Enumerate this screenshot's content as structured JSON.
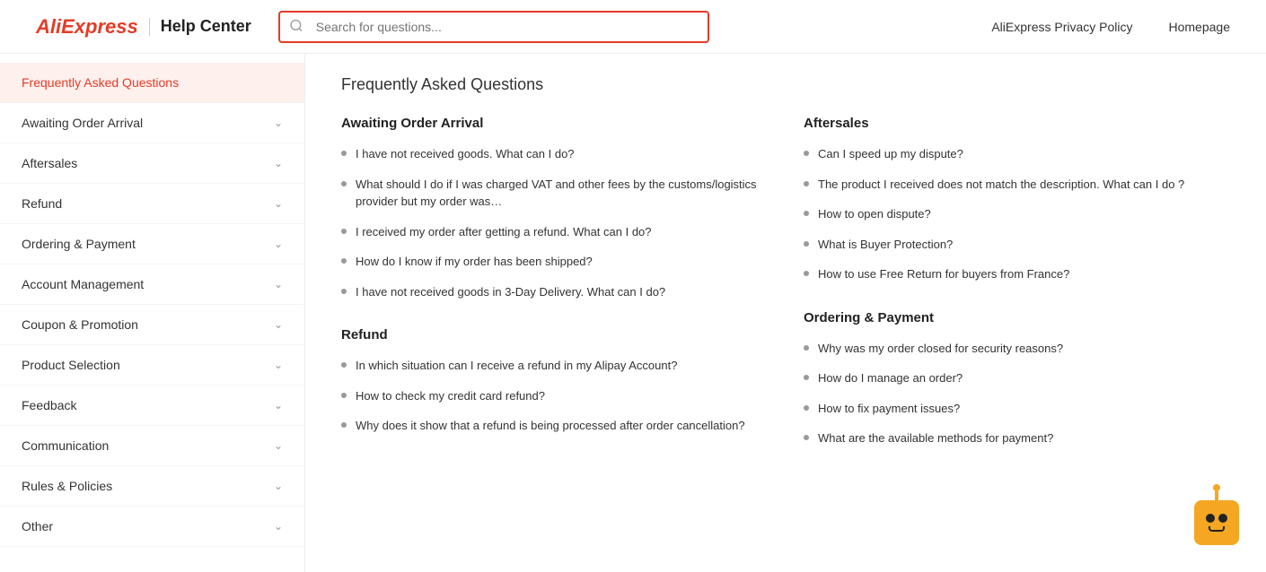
{
  "header": {
    "logo_aliexpress": "AliExpress",
    "logo_divider": "|",
    "logo_helpcenter": "Help Center",
    "search_placeholder": "Search for questions...",
    "nav_links": [
      {
        "label": "AliExpress Privacy Policy"
      },
      {
        "label": "Homepage"
      }
    ]
  },
  "sidebar": {
    "items": [
      {
        "label": "Frequently Asked Questions",
        "active": true
      },
      {
        "label": "Awaiting Order Arrival",
        "active": false
      },
      {
        "label": "Aftersales",
        "active": false
      },
      {
        "label": "Refund",
        "active": false
      },
      {
        "label": "Ordering & Payment",
        "active": false
      },
      {
        "label": "Account Management",
        "active": false
      },
      {
        "label": "Coupon & Promotion",
        "active": false
      },
      {
        "label": "Product Selection",
        "active": false
      },
      {
        "label": "Feedback",
        "active": false
      },
      {
        "label": "Communication",
        "active": false
      },
      {
        "label": "Rules & Policies",
        "active": false
      },
      {
        "label": "Other",
        "active": false
      }
    ]
  },
  "content": {
    "page_title": "Frequently Asked Questions",
    "sections": [
      {
        "title": "Awaiting Order Arrival",
        "items": [
          "I have not received goods. What can I do?",
          "What should I do if I was charged VAT and other fees by the customs/logistics provider but my order was…",
          "I received my order after getting a refund. What can I do?",
          "How do I know if my order has been shipped?",
          "I have not received goods in 3-Day Delivery. What can I do?"
        ]
      },
      {
        "title": "Aftersales",
        "items": [
          "Can I speed up my dispute?",
          "The product I received does not match the description. What can I do ?",
          "How to open dispute?",
          "What is Buyer Protection?",
          "How to use Free Return for buyers from France?"
        ]
      },
      {
        "title": "Refund",
        "items": [
          "In which situation can I receive a refund in my Alipay Account?",
          "How to check my credit card refund?",
          "Why does it show that a refund is being processed after order cancellation?"
        ]
      },
      {
        "title": "Ordering & Payment",
        "items": [
          "Why was my order closed for security reasons?",
          "How do I manage an order?",
          "How to fix payment issues?",
          "What are the available methods for payment?"
        ]
      }
    ]
  }
}
